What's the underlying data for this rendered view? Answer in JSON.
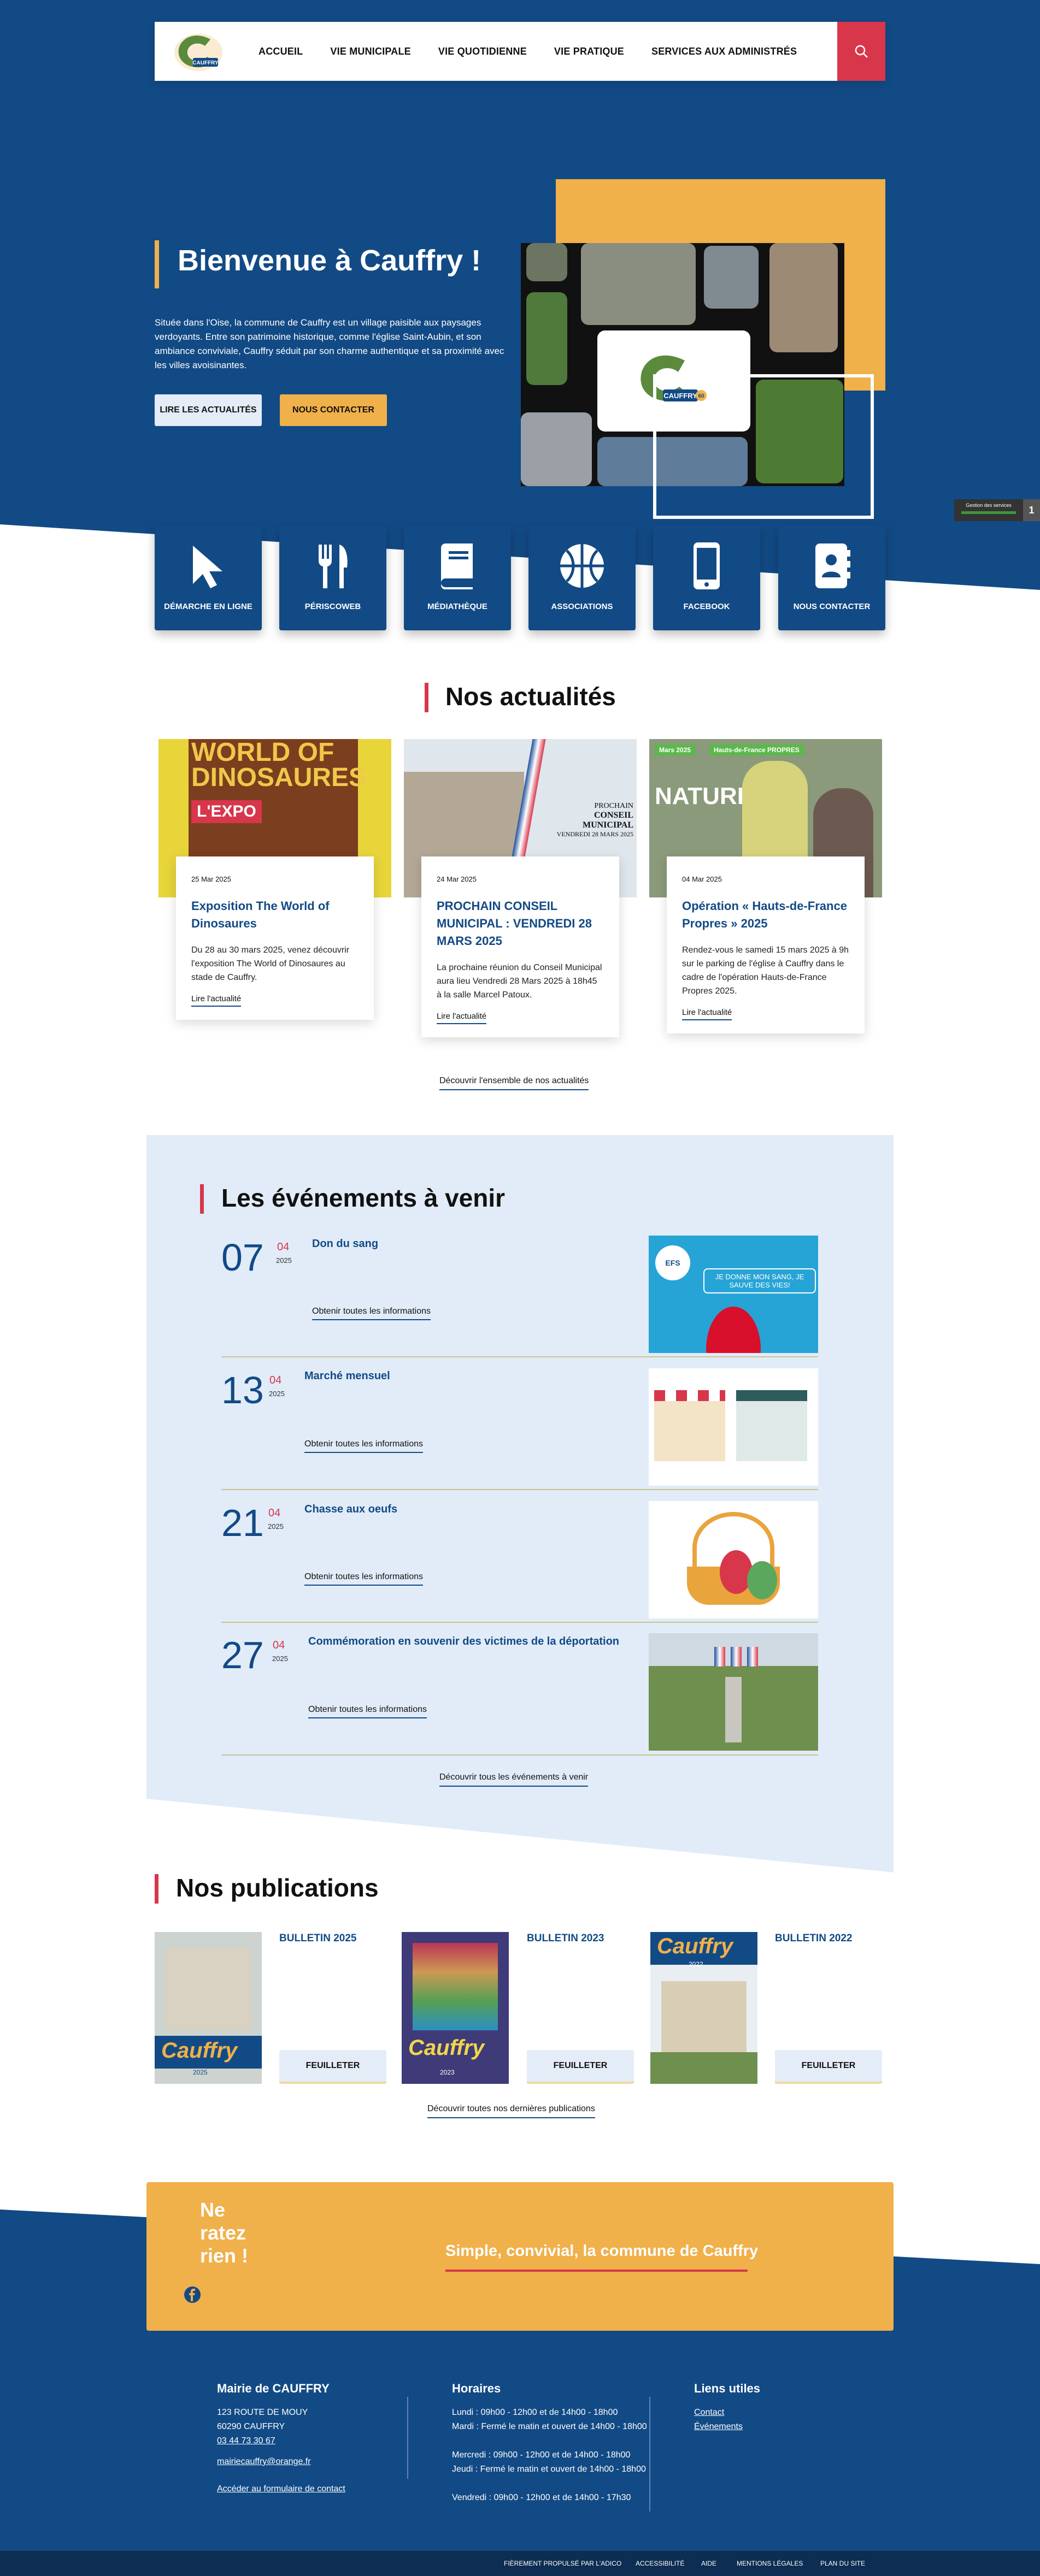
{
  "header": {
    "logo_alt": "Cauffry logo",
    "nav": [
      "ACCUEIL",
      "VIE MUNICIPALE",
      "VIE QUOTIDIENNE",
      "VIE PRATIQUE",
      "SERVICES AUX ADMINISTRÉS"
    ],
    "search_icon": "search-icon"
  },
  "hero": {
    "title": "Bienvenue à Cauffry !",
    "text": "Située dans l'Oise, la commune de Cauffry est un village paisible aux paysages verdoyants. Entre son patrimoine historique, comme l'église Saint-Aubin, et son ambiance conviviale, Cauffry séduit par son charme authentique et sa proximité avec les villes avoisinantes.",
    "btn_news": "LIRE LES ACTUALITÉS",
    "btn_contact": "NOUS CONTACTER",
    "logo_text": "CAUFFRY",
    "logo_badge": "60"
  },
  "side_widget": {
    "label": "Gestion des services",
    "count": "1"
  },
  "quick_links": [
    {
      "label": "DÉMARCHE EN LIGNE",
      "icon": "cursor-icon"
    },
    {
      "label": "PÉRISCOWEB",
      "icon": "fork-knife-icon"
    },
    {
      "label": "MÉDIATHÈQUE",
      "icon": "book-icon"
    },
    {
      "label": "ASSOCIATIONS",
      "icon": "basketball-icon"
    },
    {
      "label": "FACEBOOK",
      "icon": "mobile-icon"
    },
    {
      "label": "NOUS CONTACTER",
      "icon": "contact-card-icon"
    }
  ],
  "news": {
    "title": "Nos actualités",
    "items": [
      {
        "date": "25 Mar 2025",
        "title": "Exposition The World of Dinosaures",
        "text": "Du 28 au 30 mars 2025, venez découvrir l'exposition The World of Dinosaures au stade de Cauffry.",
        "link": "Lire l'actualité",
        "img_text_1": "WORLD OF",
        "img_text_2": "DINOSAURES",
        "img_text_3": "L'EXPO"
      },
      {
        "date": "24 Mar 2025",
        "title": "PROCHAIN CONSEIL MUNICIPAL : VENDREDI 28 MARS 2025",
        "text": "La prochaine réunion du Conseil Municipal aura lieu Vendredi 28 Mars 2025 à 18h45 à la salle Marcel Patoux.",
        "link": "Lire l'actualité",
        "img_text_1": "PROCHAIN",
        "img_text_2": "CONSEIL MUNICIPAL",
        "img_text_3": "VENDREDI 28 MARS 2025"
      },
      {
        "date": "04 Mar 2025",
        "title": "Opération « Hauts-de-France Propres » 2025",
        "text": "Rendez-vous le samedi 15 mars 2025 à 9h sur le parking de l'église à Cauffry dans le cadre de l'opération Hauts-de-France Propres 2025.",
        "link": "Lire l'actualité",
        "img_text_1": "NATURE !",
        "img_text_2": "Hauts-de-France PROPRES",
        "img_text_3": "Mars 2025"
      }
    ],
    "all_link": "Découvrir l'ensemble de nos actualités"
  },
  "events": {
    "title": "Les événements à venir",
    "items": [
      {
        "day": "07",
        "month": "04",
        "year": "2025",
        "title": "Don du sang",
        "link": "Obtenir toutes les informations",
        "img_text": "JE DONNE MON SANG, JE SAUVE DES VIES!",
        "img_badge": "EFS"
      },
      {
        "day": "13",
        "month": "04",
        "year": "2025",
        "title": "Marché mensuel",
        "link": "Obtenir toutes les informations"
      },
      {
        "day": "21",
        "month": "04",
        "year": "2025",
        "title": "Chasse aux oeufs",
        "link": "Obtenir toutes les informations"
      },
      {
        "day": "27",
        "month": "04",
        "year": "2025",
        "title": "Commémoration en souvenir des victimes de la déportation",
        "link": "Obtenir toutes les informations"
      }
    ],
    "all_link": "Découvrir tous les événements à venir"
  },
  "publications": {
    "title": "Nos publications",
    "items": [
      {
        "title": "BULLETIN 2025",
        "button": "FEUILLETER",
        "cover_text": "Cauffry",
        "cover_year": "2025"
      },
      {
        "title": "BULLETIN 2023",
        "button": "FEUILLETER",
        "cover_text": "Cauffry",
        "cover_year": "2023"
      },
      {
        "title": "BULLETIN 2022",
        "button": "FEUILLETER",
        "cover_text": "Cauffry",
        "cover_year": "2022"
      }
    ],
    "all_link": "Découvrir toutes nos dernières publications"
  },
  "newsletter": {
    "text": "Ne ratez rien !",
    "slogan": "Simple, convivial, la commune de Cauffry",
    "facebook_icon": "facebook-icon"
  },
  "footer": {
    "mairie_title": "Mairie de CAUFFRY",
    "address_1": "123 ROUTE DE MOUY",
    "address_2": "60290 CAUFFRY",
    "phone": "03 44 73 30 67",
    "email": "mairiecauffry@orange.fr",
    "contact_form": "Accéder au formulaire de contact",
    "hours_title": "Horaires",
    "hours": [
      "Lundi : 09h00 - 12h00 et de 14h00 - 18h00",
      "Mardi : Fermé le matin et ouvert de 14h00 - 18h00",
      "Mercredi : 09h00 - 12h00 et de 14h00 - 18h00",
      "Jeudi : Fermé le matin et ouvert de 14h00 - 18h00",
      "Vendredi : 09h00 - 12h00 et de 14h00 - 17h30"
    ],
    "links_title": "Liens utiles",
    "links": [
      "Contact",
      "Événements"
    ]
  },
  "bottom_bar": [
    "FIÈREMENT PROPULSÉ PAR L'ADICO",
    "ACCESSIBILITÉ",
    "AIDE",
    "MENTIONS LÉGALES",
    "PLAN DU SITE"
  ],
  "colors": {
    "primary": "#124a85",
    "accent": "#f0b04a",
    "red": "#d8364b",
    "light": "#e1ecf8"
  }
}
